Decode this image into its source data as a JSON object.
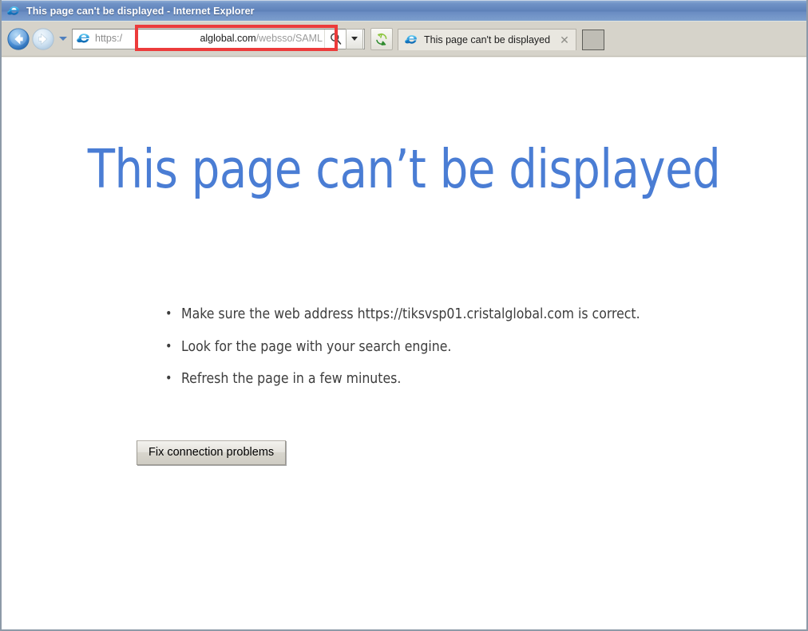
{
  "window": {
    "title": "This page can't be displayed - Internet Explorer",
    "app_icon": "internet-explorer-icon"
  },
  "toolbar": {
    "back_icon": "back-arrow-icon",
    "forward_icon": "forward-arrow-icon",
    "recent_pages_icon": "chevron-down-icon",
    "refresh_icon": "refresh-icon",
    "address_bar": {
      "icon": "internet-explorer-icon",
      "scheme": "https:/",
      "domain": "alglobal.com",
      "path": "/websso/SAML",
      "search_icon": "search-icon",
      "dropdown_icon": "chevron-down-icon"
    }
  },
  "tabs": [
    {
      "icon": "internet-explorer-icon",
      "label": "This page can't be displayed",
      "close_icon": "close-icon",
      "active": true
    }
  ],
  "new_tab": {
    "label": ""
  },
  "annotation": {
    "type": "rectangle-highlight",
    "color": "#ec3b3b",
    "target": "address-bar"
  },
  "page": {
    "heading": "This page can’t be displayed",
    "heading_color": "#4a7dd4",
    "suggestions": [
      "Make sure the web address https://tiksvsp01.cristalglobal.com is correct.",
      "Look for the page with your search engine.",
      "Refresh the page in a few minutes."
    ],
    "fix_button_label": "Fix connection problems"
  }
}
